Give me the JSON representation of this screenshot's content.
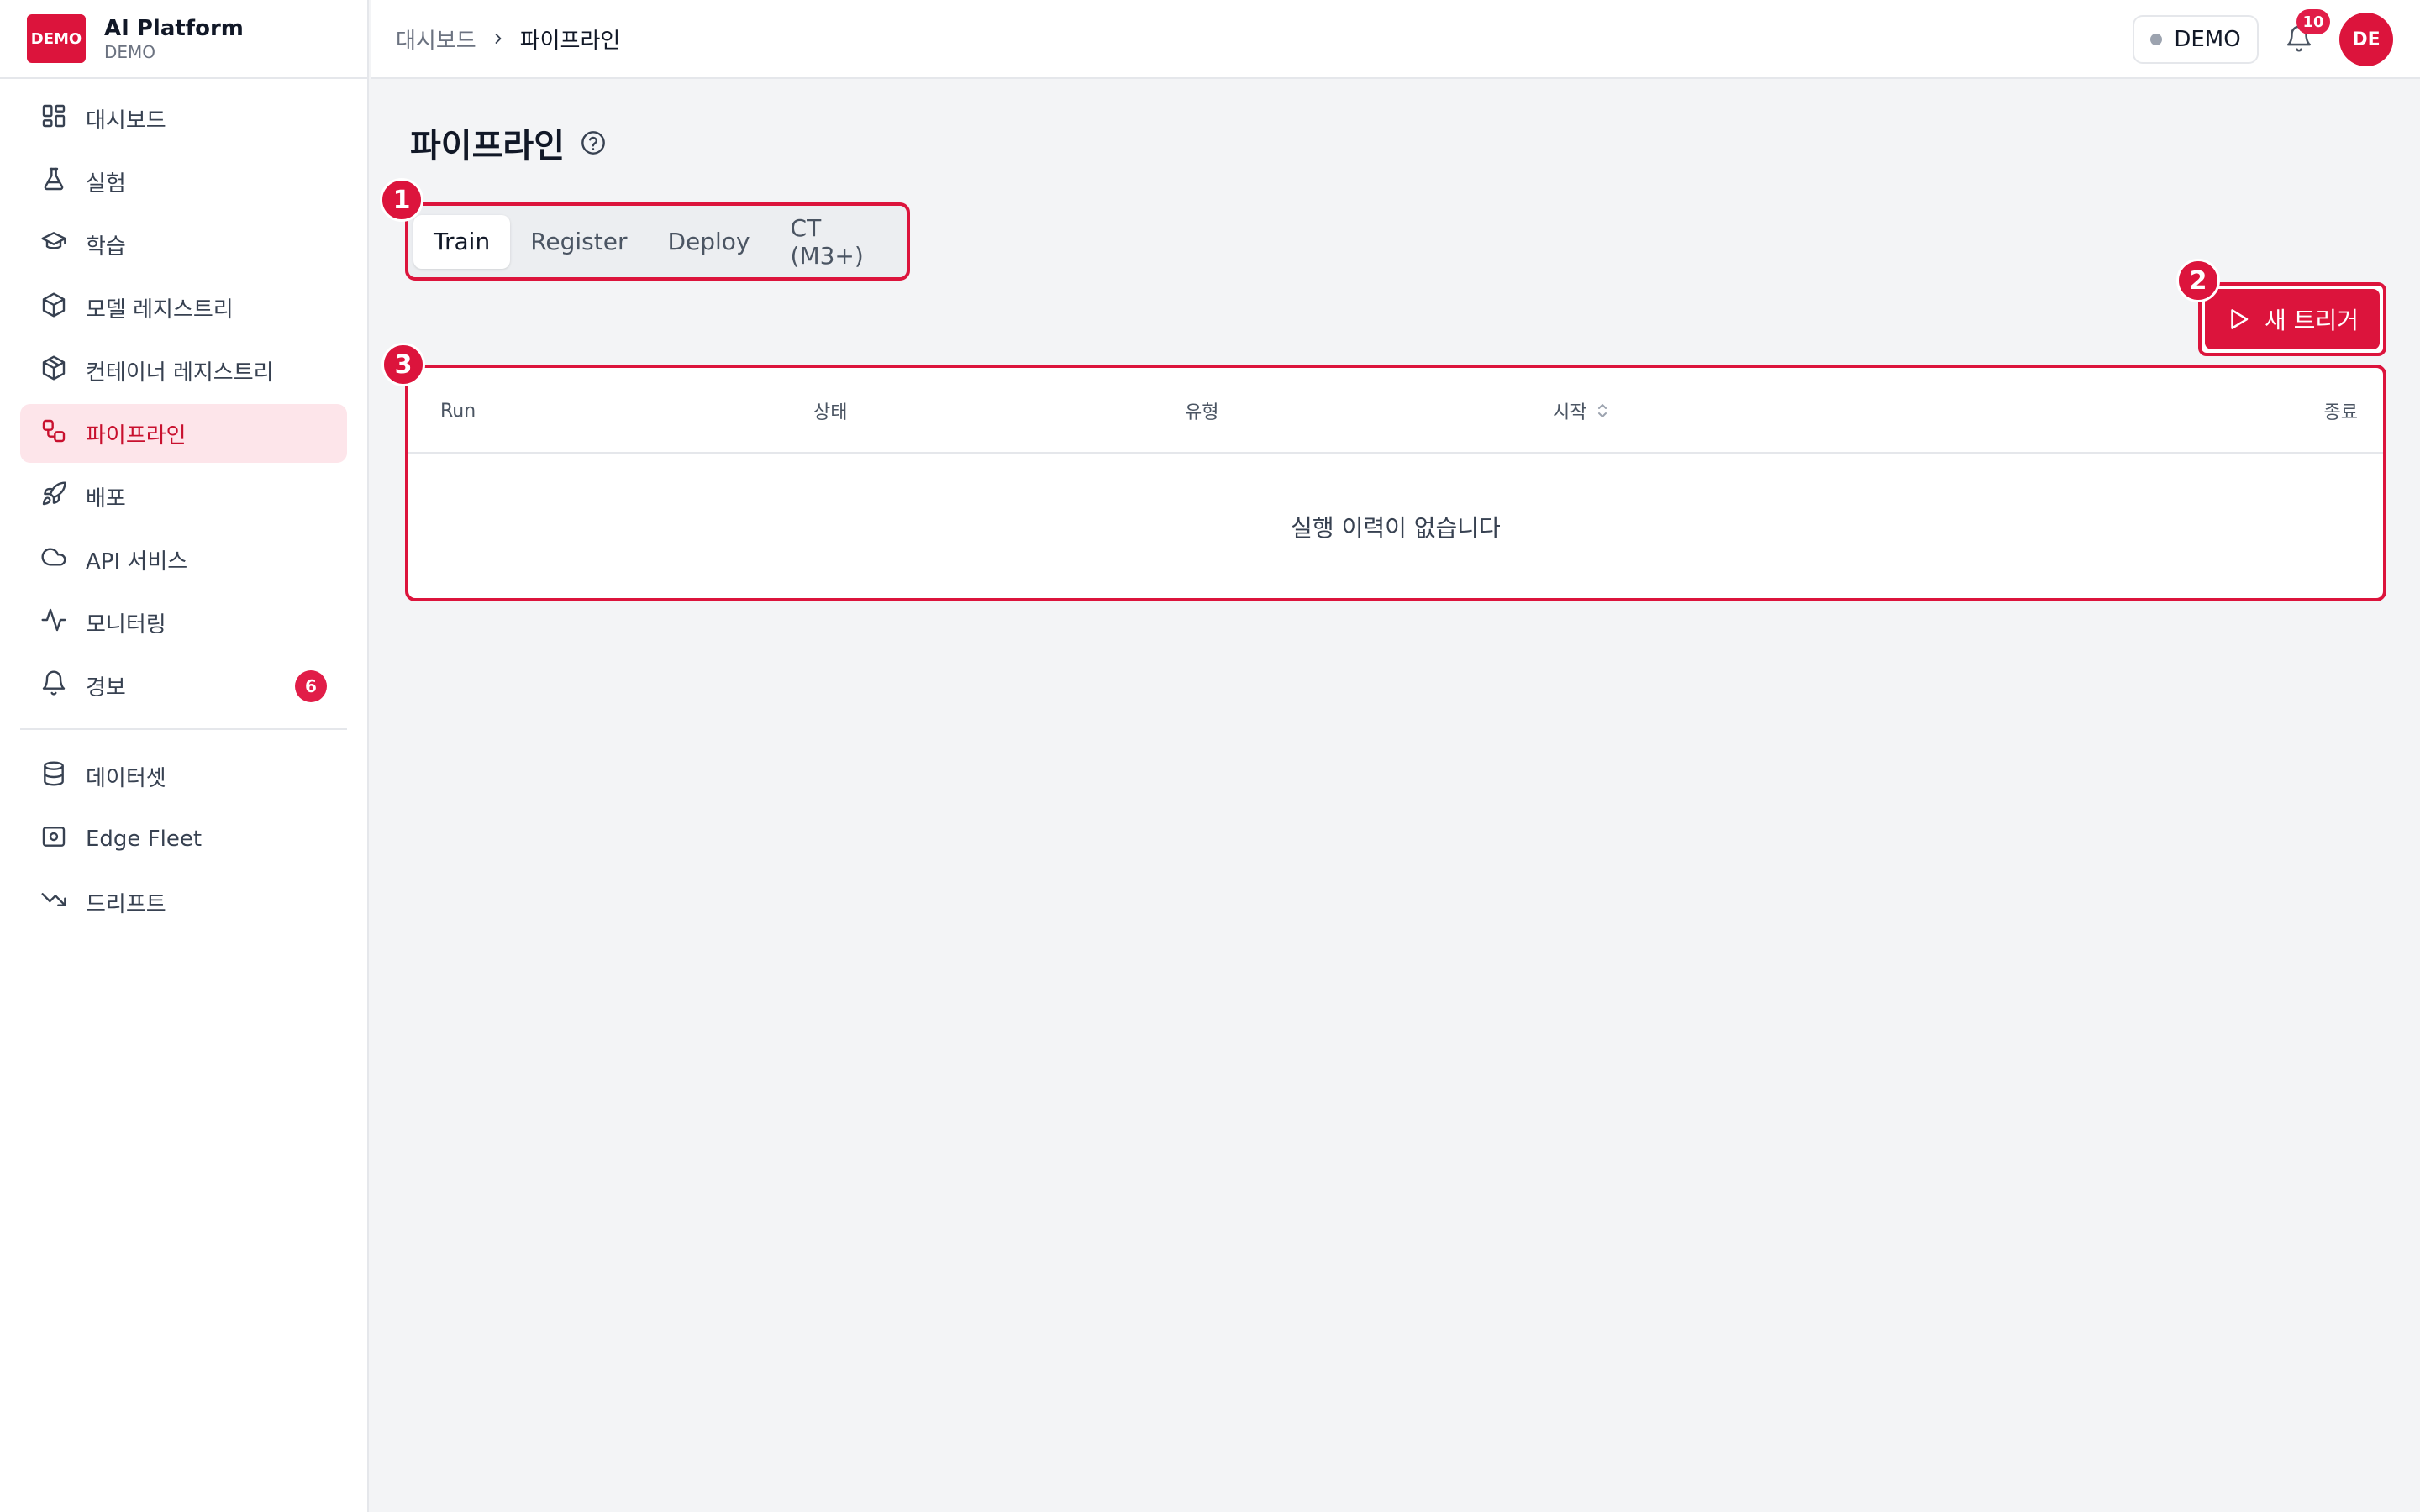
{
  "brand": {
    "logo_text": "DEMO",
    "name": "AI Platform",
    "sub": "DEMO"
  },
  "sidebar": {
    "items": [
      {
        "label": "대시보드",
        "icon": "dashboard-icon"
      },
      {
        "label": "실험",
        "icon": "flask-icon"
      },
      {
        "label": "학습",
        "icon": "graduation-cap-icon"
      },
      {
        "label": "모델 레지스트리",
        "icon": "box-icon"
      },
      {
        "label": "컨테이너 레지스트리",
        "icon": "container-icon"
      },
      {
        "label": "파이프라인",
        "icon": "workflow-icon",
        "active": true
      },
      {
        "label": "배포",
        "icon": "rocket-icon"
      },
      {
        "label": "API 서비스",
        "icon": "cloud-icon"
      },
      {
        "label": "모니터링",
        "icon": "activity-icon"
      },
      {
        "label": "경보",
        "icon": "bell-icon",
        "badge": "6"
      }
    ],
    "secondary_items": [
      {
        "label": "데이터셋",
        "icon": "database-icon"
      },
      {
        "label": "Edge Fleet",
        "icon": "router-icon"
      },
      {
        "label": "드리프트",
        "icon": "trending-down-icon"
      }
    ]
  },
  "topbar": {
    "breadcrumb_home": "대시보드",
    "breadcrumb_current": "파이프라인",
    "env_label": "DEMO",
    "notification_count": "10",
    "avatar_initials": "DE"
  },
  "main": {
    "title": "파이프라인",
    "tabs": [
      {
        "label": "Train",
        "active": true
      },
      {
        "label": "Register"
      },
      {
        "label": "Deploy"
      },
      {
        "label": "CT (M3+)"
      }
    ],
    "trigger_label": "새 트리거",
    "markers": [
      "1",
      "2",
      "3"
    ],
    "table": {
      "columns": {
        "run": "Run",
        "status": "상태",
        "type": "유형",
        "start": "시작",
        "end": "종료"
      },
      "empty_message": "실행 이력이 없습니다"
    }
  },
  "colors": {
    "accent": "#dc143c",
    "active_bg": "#fde5ea",
    "badge": "#e11d48"
  }
}
